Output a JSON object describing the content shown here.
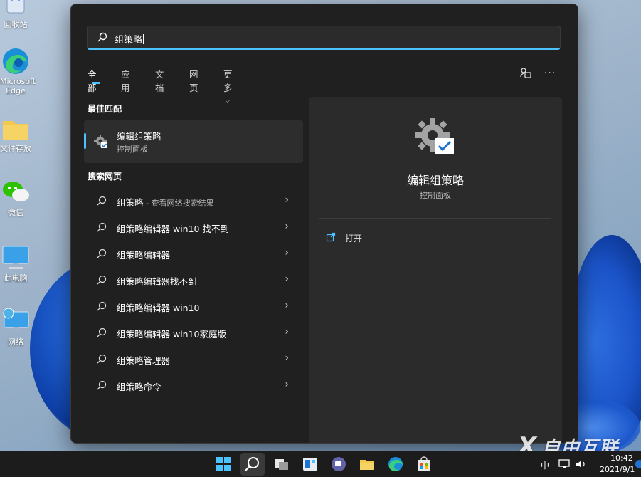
{
  "desktop": {
    "icons": [
      {
        "name": "recycle-bin",
        "label": "回收站"
      },
      {
        "name": "edge",
        "label": "Microsoft Edge"
      },
      {
        "name": "folder",
        "label": "文件存放"
      },
      {
        "name": "wechat",
        "label": "微信"
      },
      {
        "name": "this-pc",
        "label": "此电脑"
      },
      {
        "name": "network",
        "label": "网络"
      }
    ]
  },
  "search": {
    "query": "组策略"
  },
  "tabs": [
    {
      "label": "全部",
      "active": true
    },
    {
      "label": "应用"
    },
    {
      "label": "文档"
    },
    {
      "label": "网页"
    },
    {
      "label": "更多"
    }
  ],
  "best_match": {
    "section_title": "最佳匹配",
    "title": "编辑组策略",
    "subtitle": "控制面板"
  },
  "web": {
    "section_title": "搜索网页",
    "items": [
      {
        "text": "组策略",
        "sub": " - 查看网络搜索结果"
      },
      {
        "text": "组策略编辑器 win10 找不到"
      },
      {
        "text": "组策略编辑器"
      },
      {
        "text": "组策略编辑器找不到"
      },
      {
        "text": "组策略编辑器 win10"
      },
      {
        "text": "组策略编辑器 win10家庭版"
      },
      {
        "text": "组策略管理器"
      },
      {
        "text": "组策略命令"
      }
    ]
  },
  "detail": {
    "title": "编辑组策略",
    "subtitle": "控制面板",
    "action_open": "打开"
  },
  "taskbar": {
    "language": "中",
    "time": "10:42",
    "date": "2021/9/1"
  },
  "watermark": {
    "logo": "X",
    "text": "自由互联"
  },
  "colors": {
    "accent": "#4cc2ff",
    "panel": "#202020",
    "right_pane": "#2b2b2b"
  }
}
